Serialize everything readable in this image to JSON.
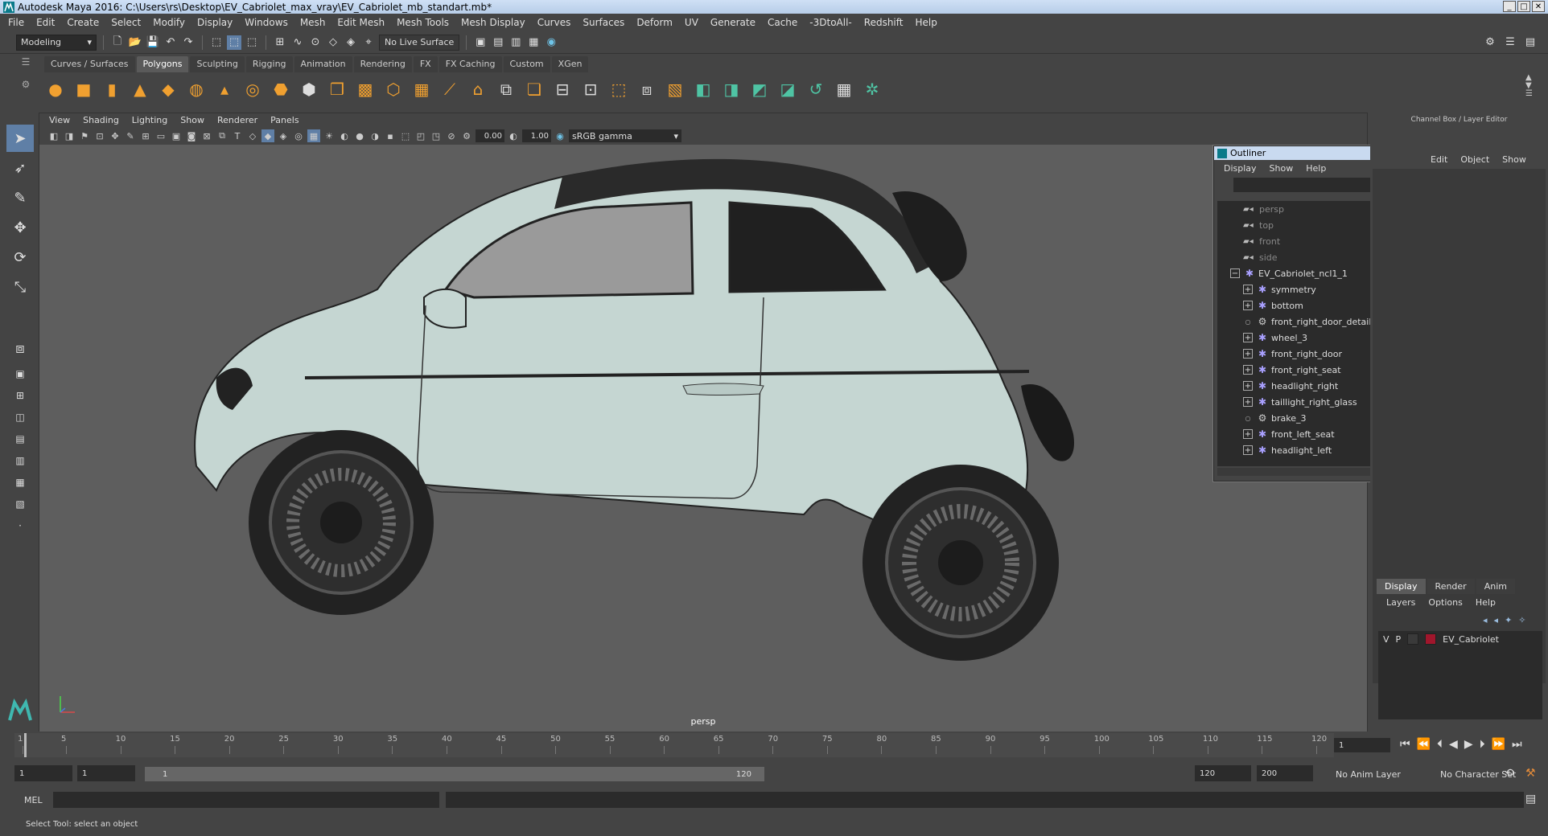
{
  "window": {
    "title": "Autodesk Maya 2016: C:\\Users\\rs\\Desktop\\EV_Cabriolet_max_vray\\EV_Cabriolet_mb_standart.mb*"
  },
  "menubar": [
    "File",
    "Edit",
    "Create",
    "Select",
    "Modify",
    "Display",
    "Windows",
    "Mesh",
    "Edit Mesh",
    "Mesh Tools",
    "Mesh Display",
    "Curves",
    "Surfaces",
    "Deform",
    "UV",
    "Generate",
    "Cache",
    "-3DtoAll-",
    "Redshift",
    "Help"
  ],
  "statusline": {
    "mode": "Modeling",
    "live_surface": "No Live Surface"
  },
  "shelf": {
    "tabs": [
      "Curves / Surfaces",
      "Polygons",
      "Sculpting",
      "Rigging",
      "Animation",
      "Rendering",
      "FX",
      "FX Caching",
      "Custom",
      "XGen"
    ],
    "active_tab": "Polygons"
  },
  "viewport": {
    "menu": [
      "View",
      "Shading",
      "Lighting",
      "Show",
      "Renderer",
      "Panels"
    ],
    "exposure": "0.00",
    "gamma": "1.00",
    "color_space": "sRGB gamma",
    "camera_label": "persp",
    "car_color": "#c5d6d2"
  },
  "outliner": {
    "title": "Outliner",
    "menu": [
      "Display",
      "Show",
      "Help"
    ],
    "items": [
      {
        "label": "persp",
        "type": "camera",
        "depth": 1,
        "dim": true
      },
      {
        "label": "top",
        "type": "camera",
        "depth": 1,
        "dim": true
      },
      {
        "label": "front",
        "type": "camera",
        "depth": 1,
        "dim": true
      },
      {
        "label": "side",
        "type": "camera",
        "depth": 1,
        "dim": true
      },
      {
        "label": "EV_Cabriolet_ncl1_1",
        "type": "group",
        "depth": 0,
        "expand": "−"
      },
      {
        "label": "symmetry",
        "type": "group",
        "depth": 1,
        "expand": "+"
      },
      {
        "label": "bottom",
        "type": "group",
        "depth": 1,
        "expand": "+"
      },
      {
        "label": "front_right_door_detail",
        "type": "mesh",
        "depth": 1,
        "expand": ""
      },
      {
        "label": "wheel_3",
        "type": "group",
        "depth": 1,
        "expand": "+"
      },
      {
        "label": "front_right_door",
        "type": "group",
        "depth": 1,
        "expand": "+"
      },
      {
        "label": "front_right_seat",
        "type": "group",
        "depth": 1,
        "expand": "+"
      },
      {
        "label": "headlight_right",
        "type": "group",
        "depth": 1,
        "expand": "+"
      },
      {
        "label": "taillight_right_glass",
        "type": "group",
        "depth": 1,
        "expand": "+"
      },
      {
        "label": "brake_3",
        "type": "mesh",
        "depth": 1,
        "expand": ""
      },
      {
        "label": "front_left_seat",
        "type": "group",
        "depth": 1,
        "expand": "+"
      },
      {
        "label": "headlight_left",
        "type": "group",
        "depth": 1,
        "expand": "+"
      }
    ]
  },
  "channel_box": {
    "header": "Channel Box / Layer Editor",
    "menu": [
      "Edit",
      "Object",
      "Show"
    ]
  },
  "layer_editor": {
    "tabs": [
      "Display",
      "Render",
      "Anim"
    ],
    "active_tab": "Display",
    "menu": [
      "Layers",
      "Options",
      "Help"
    ],
    "layers": [
      {
        "v": "V",
        "p": "P",
        "name": "EV_Cabriolet",
        "color": "#a0162c"
      }
    ]
  },
  "timeline": {
    "ticks": [
      "1",
      "5",
      "10",
      "15",
      "20",
      "25",
      "30",
      "35",
      "40",
      "45",
      "50",
      "55",
      "60",
      "65",
      "70",
      "75",
      "80",
      "85",
      "90",
      "95",
      "100",
      "105",
      "110",
      "115",
      "120"
    ],
    "current_frame": "1",
    "start": "1",
    "playback_start": "1",
    "range_start": "1",
    "range_end": "120",
    "playback_end": "120",
    "end": "200",
    "anim_layer": "No Anim Layer",
    "character_set": "No Character Set"
  },
  "command_line": {
    "label": "MEL"
  },
  "help_line": "Select Tool: select an object"
}
